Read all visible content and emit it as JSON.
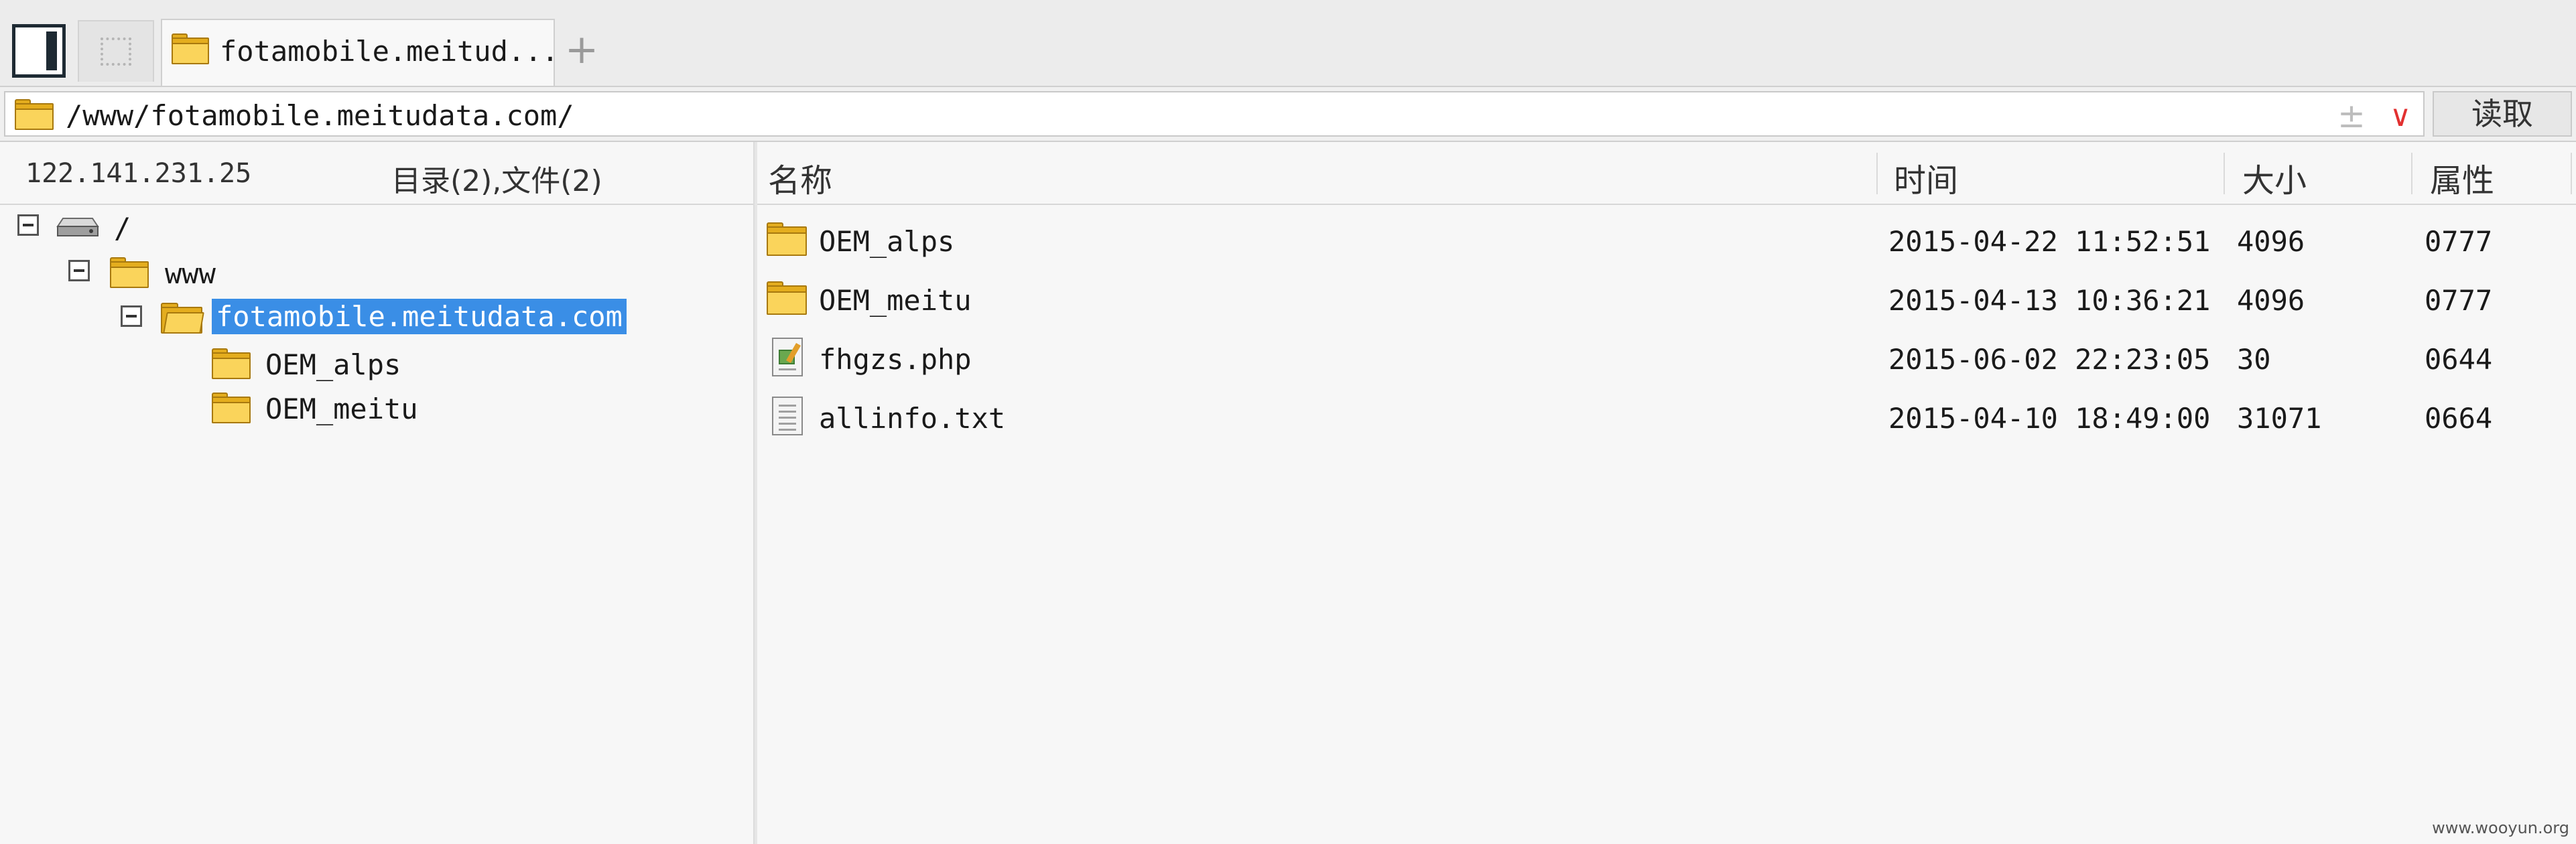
{
  "tabs": {
    "active_title": "fotamobile.meitud...",
    "add_symbol": "+"
  },
  "address": {
    "path": "/www/fotamobile.meitudata.com/",
    "bookmark_symbol": "±",
    "dropdown_symbol": "∨",
    "read_label": "读取"
  },
  "left_header": {
    "host": "122.141.231.25",
    "summary": "目录(2),文件(2)"
  },
  "tree": [
    {
      "label": "/",
      "icon": "drive-icon",
      "expanded": true
    },
    {
      "label": "www",
      "icon": "folder-icon",
      "expanded": true
    },
    {
      "label": "fotamobile.meitudata.com",
      "icon": "folder-open-icon",
      "expanded": true,
      "selected": true
    },
    {
      "label": "OEM_alps",
      "icon": "folder-icon"
    },
    {
      "label": "OEM_meitu",
      "icon": "folder-icon"
    }
  ],
  "columns": {
    "name": "名称",
    "time": "时间",
    "size": "大小",
    "attr": "属性"
  },
  "files": [
    {
      "name": "OEM_alps",
      "time": "2015-04-22 11:52:51",
      "size": "4096",
      "attr": "0777",
      "icon": "folder-icon"
    },
    {
      "name": "OEM_meitu",
      "time": "2015-04-13 10:36:21",
      "size": "4096",
      "attr": "0777",
      "icon": "folder-icon"
    },
    {
      "name": "fhgzs.php",
      "time": "2015-06-02 22:23:05",
      "size": "30",
      "attr": "0644",
      "icon": "php-file-icon"
    },
    {
      "name": "allinfo.txt",
      "time": "2015-04-10 18:49:00",
      "size": "31071",
      "attr": "0664",
      "icon": "text-file-icon"
    }
  ],
  "watermark": "www.wooyun.org"
}
